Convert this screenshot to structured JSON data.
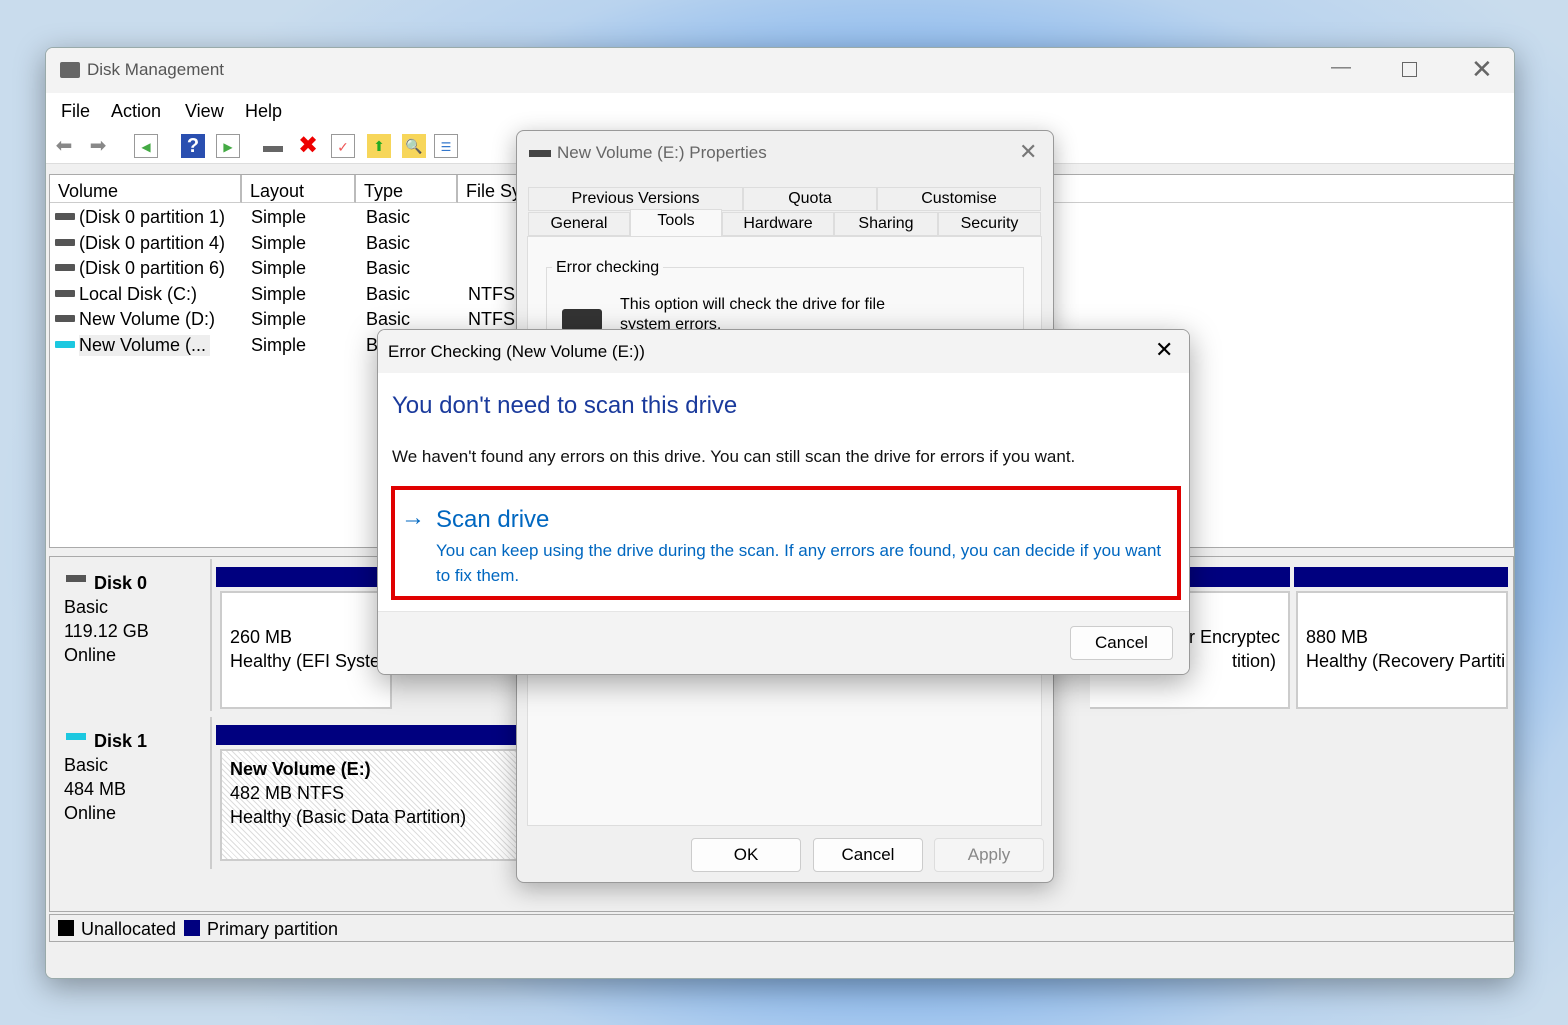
{
  "main_window": {
    "title": "Disk Management",
    "menu": [
      "File",
      "Action",
      "View",
      "Help"
    ],
    "columns": [
      "Volume",
      "Layout",
      "Type",
      "File Sy"
    ],
    "volumes": [
      {
        "name": "(Disk 0 partition 1)",
        "layout": "Simple",
        "type": "Basic",
        "fs": ""
      },
      {
        "name": "(Disk 0 partition 4)",
        "layout": "Simple",
        "type": "Basic",
        "fs": ""
      },
      {
        "name": "(Disk 0 partition 6)",
        "layout": "Simple",
        "type": "Basic",
        "fs": ""
      },
      {
        "name": "Local Disk (C:)",
        "layout": "Simple",
        "type": "Basic",
        "fs": "NTFS"
      },
      {
        "name": "New Volume (D:)",
        "layout": "Simple",
        "type": "Basic",
        "fs": "NTFS"
      },
      {
        "name": "New Volume (...",
        "layout": "Simple",
        "type": "B",
        "fs": ""
      }
    ],
    "disk0": {
      "name": "Disk 0",
      "type": "Basic",
      "size": "119.12 GB",
      "status": "Online",
      "p1_size": "260 MB",
      "p1_status": "Healthy (EFI System",
      "p_mid1": "r Encryptec",
      "p_mid2": "tition)",
      "p_last_size": "880 MB",
      "p_last_status": "Healthy (Recovery Partiti"
    },
    "disk1": {
      "name": "Disk 1",
      "type": "Basic",
      "size": "484 MB",
      "status": "Online",
      "vol_name": "New Volume  (E:)",
      "vol_size": "482 MB NTFS",
      "vol_status": "Healthy (Basic Data Partition)"
    },
    "legend": [
      "Unallocated",
      "Primary partition"
    ],
    "colors": {
      "primary": "#00007f",
      "unallocated": "#000000"
    }
  },
  "properties": {
    "title": "New Volume (E:) Properties",
    "tabs_row1": [
      "Previous Versions",
      "Quota",
      "Customise"
    ],
    "tabs_row2": [
      "General",
      "Tools",
      "Hardware",
      "Sharing",
      "Security"
    ],
    "active_tab": "Tools",
    "group": "Error checking",
    "desc": "This option will check the drive for file system errors.",
    "ok": "OK",
    "cancel": "Cancel",
    "apply": "Apply"
  },
  "error_dialog": {
    "title": "Error Checking (New Volume (E:))",
    "heading": "You don't need to scan this drive",
    "message": "We haven't found any errors on this drive. You can still scan the drive for errors if you want.",
    "scan_title": "Scan drive",
    "scan_desc": "You can keep using the drive during the scan. If any errors are found, you can decide if you want to fix them.",
    "cancel": "Cancel",
    "accent": "#0067c0",
    "highlight": "#e00000"
  }
}
